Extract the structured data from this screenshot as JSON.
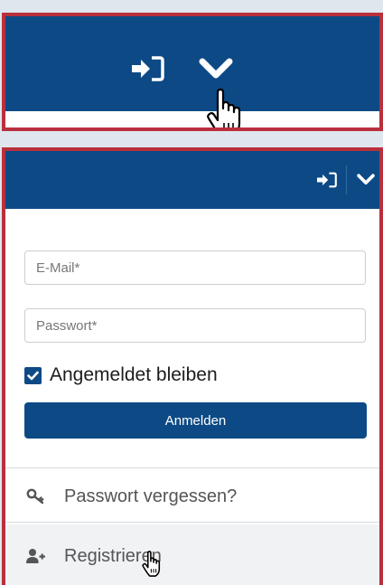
{
  "login_form": {
    "email_placeholder": "E-Mail*",
    "password_placeholder": "Passwort*",
    "remember_label": "Angemeldet bleiben",
    "remember_checked": true,
    "submit_label": "Anmelden"
  },
  "links": {
    "forgot_password": "Passwort vergessen?",
    "register": "Registrieren"
  },
  "icons": {
    "toolbar": [
      "sign-in-icon",
      "chevron-down-icon"
    ],
    "cursor": "hand-pointer-icon",
    "forgot_password": "key-icon",
    "register": "user-plus-icon"
  },
  "colors": {
    "brand_blue": "#0d4a85",
    "highlight_border": "#b9303c",
    "background": "#dfe6ed"
  }
}
